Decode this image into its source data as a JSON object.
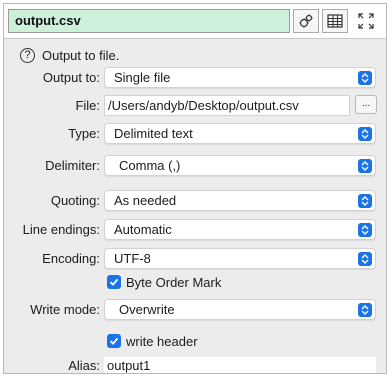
{
  "header": {
    "name": "output.csv",
    "settings_icon": "gears-icon",
    "table_icon": "table-icon",
    "expand_icon": "expand-icon"
  },
  "help": {
    "icon": "question-circle-icon",
    "text": "Output to file."
  },
  "fields": {
    "output_to": {
      "label": "Output to:",
      "value": "Single file"
    },
    "file": {
      "label": "File:",
      "value": "/Users/andyb/Desktop/output.csv",
      "browse": "..."
    },
    "type": {
      "label": "Type:",
      "value": "Delimited text"
    },
    "delimiter": {
      "label": "Delimiter:",
      "value": "Comma (,)"
    },
    "quoting": {
      "label": "Quoting:",
      "value": "As needed"
    },
    "line_endings": {
      "label": "Line endings:",
      "value": "Automatic"
    },
    "encoding": {
      "label": "Encoding:",
      "value": "UTF-8"
    },
    "bom": {
      "label": "Byte Order Mark",
      "checked": true
    },
    "write_mode": {
      "label": "Write mode:",
      "value": "Overwrite"
    },
    "write_header": {
      "label": "write header",
      "checked": true
    },
    "alias": {
      "label": "Alias:",
      "value": "output1"
    }
  },
  "colors": {
    "accent": "#1b73e8",
    "name_field_bg": "#cdf0da",
    "panel_bg": "#ececec"
  }
}
